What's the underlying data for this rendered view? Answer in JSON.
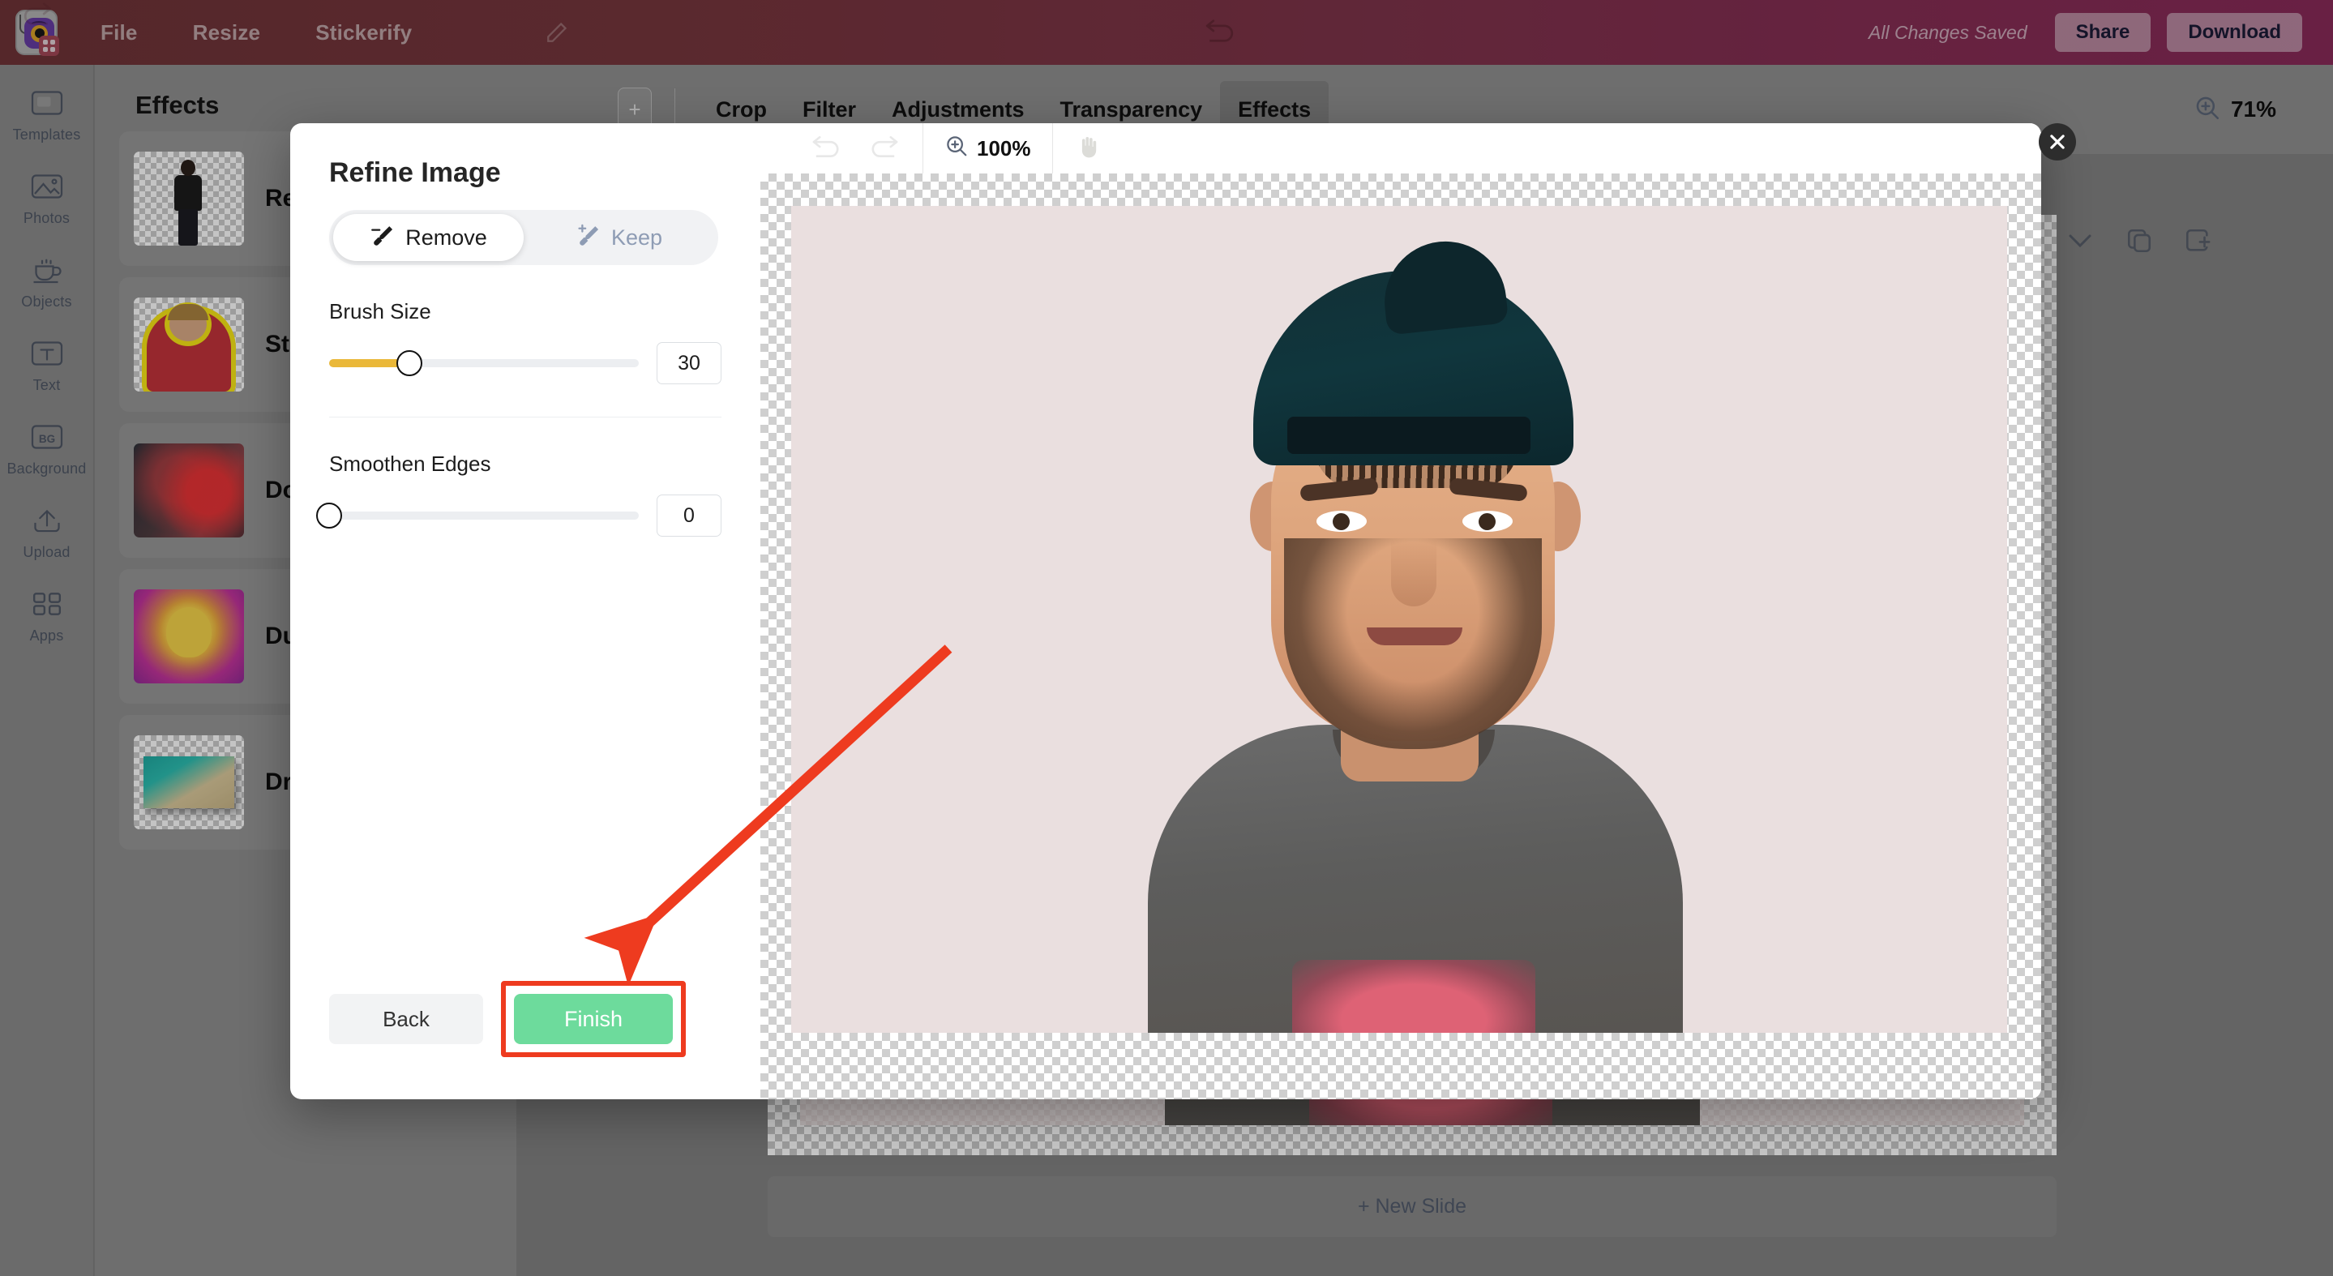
{
  "topbar": {
    "logo_icon": "app-logo-icon",
    "menu": [
      "File",
      "Resize",
      "Stickerify"
    ],
    "pencil_icon": "pencil-icon",
    "undo_icon": "undo-icon",
    "redo_icon": "redo-icon",
    "saved_status": "All Changes Saved",
    "share_label": "Share",
    "download_label": "Download",
    "gradient_from": "#73363a",
    "gradient_to": "#8e2d5d"
  },
  "rail": {
    "items": [
      {
        "label": "Templates",
        "icon": "templates-icon"
      },
      {
        "label": "Photos",
        "icon": "photos-icon"
      },
      {
        "label": "Objects",
        "icon": "objects-icon"
      },
      {
        "label": "Text",
        "icon": "text-icon"
      },
      {
        "label": "Background",
        "icon": "background-icon"
      },
      {
        "label": "Upload",
        "icon": "upload-icon"
      },
      {
        "label": "Apps",
        "icon": "apps-icon"
      }
    ]
  },
  "effects_panel": {
    "title": "Effects",
    "items": [
      {
        "label": "Remove Background",
        "thumb": "person-cutout-thumb"
      },
      {
        "label": "Sticker",
        "thumb": "sticker-outline-thumb"
      },
      {
        "label": "Double Exposure",
        "thumb": "double-exposure-thumb"
      },
      {
        "label": "Duotone",
        "thumb": "duotone-dog-thumb"
      },
      {
        "label": "Drop Shadow",
        "thumb": "drop-shadow-beach-thumb"
      }
    ]
  },
  "editor_tabs": {
    "add_slide_label": "+",
    "tabs": [
      {
        "label": "Crop",
        "active": false
      },
      {
        "label": "Filter",
        "active": false
      },
      {
        "label": "Adjustments",
        "active": false
      },
      {
        "label": "Transparency",
        "active": false
      },
      {
        "label": "Effects",
        "active": true
      }
    ],
    "zoom_value": "71%",
    "zoom_icon": "zoom-in-icon"
  },
  "workspace": {
    "slide_tools": [
      {
        "icon": "chevron-down-icon",
        "name": "slide-options-chevron"
      },
      {
        "icon": "duplicate-icon",
        "name": "duplicate-slide"
      },
      {
        "icon": "add-slide-icon",
        "name": "add-slide"
      }
    ],
    "new_slide_label": "+ New Slide",
    "canvas_background": "#eadfdf"
  },
  "modal": {
    "title": "Refine Image",
    "mode_toggle": [
      {
        "label": "Remove",
        "icon": "brush-remove-icon",
        "active": true
      },
      {
        "label": "Keep",
        "icon": "brush-keep-icon",
        "active": false
      }
    ],
    "controls": [
      {
        "label": "Brush Size",
        "value": "30",
        "fill_percent": 26,
        "accent": "#eab839"
      },
      {
        "label": "Smoothen Edges",
        "value": "0",
        "fill_percent": 0,
        "accent": "#eab839"
      }
    ],
    "back_label": "Back",
    "finish_label": "Finish",
    "finish_color": "#6ddb9c",
    "highlight_color": "#ee3b1f",
    "preview": {
      "undo_icon": "undo-icon",
      "redo_icon": "redo-icon",
      "zoom_value": "100%",
      "zoom_icon": "zoom-in-icon",
      "pan_icon": "hand-pan-icon"
    },
    "close_icon": "close-icon"
  },
  "annotation": {
    "arrow_color": "#ee3b1f",
    "arrow_from": "1170,800",
    "arrow_to": "770,1165"
  }
}
